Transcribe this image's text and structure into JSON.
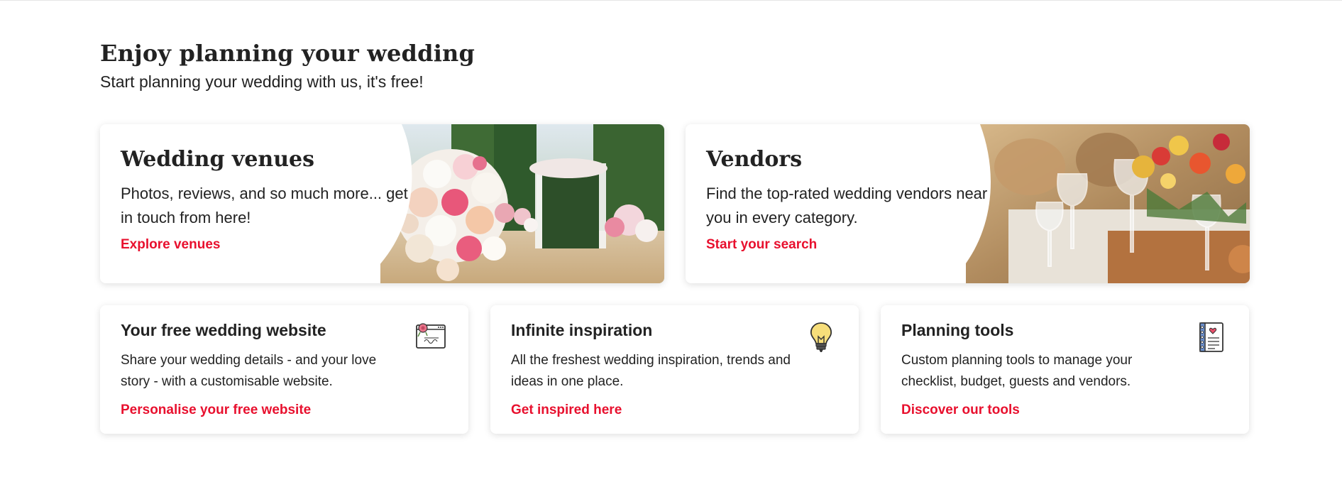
{
  "section": {
    "title": "Enjoy planning your wedding",
    "subtitle": "Start planning your wedding with us, it's free!"
  },
  "feature_cards": [
    {
      "title": "Wedding venues",
      "description": "Photos, reviews, and so much more... get in touch from here!",
      "link": "Explore venues",
      "image": "bouquet-and-ceremony-arch-photo"
    },
    {
      "title": "Vendors",
      "description": "Find the top-rated wedding vendors near you in every category.",
      "link": "Start your search",
      "image": "reception-table-glasses-photo"
    }
  ],
  "tool_cards": [
    {
      "title": "Your free wedding website",
      "description": "Share your wedding details - and your love story - with a customisable website.",
      "link": "Personalise your free website",
      "icon": "wedding-website-icon"
    },
    {
      "title": "Infinite inspiration",
      "description": "All the freshest wedding inspiration, trends and ideas in one place.",
      "link": "Get inspired here",
      "icon": "lightbulb-icon"
    },
    {
      "title": "Planning tools",
      "description": "Custom planning tools to manage your checklist, budget, guests and vendors.",
      "link": "Discover our tools",
      "icon": "planner-notebook-icon"
    }
  ],
  "colors": {
    "accent": "#e8102e",
    "text": "#222222",
    "background": "#ffffff"
  }
}
